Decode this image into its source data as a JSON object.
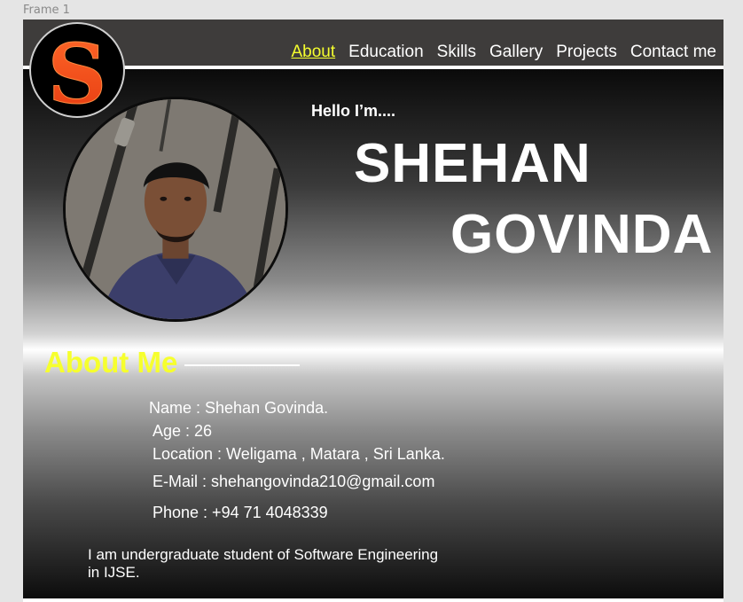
{
  "frame": {
    "label": "Frame 1"
  },
  "logo": {
    "letter": "S",
    "letter_color": "#ff4d1a"
  },
  "nav": {
    "items": [
      {
        "label": "About",
        "active": true
      },
      {
        "label": "Education",
        "active": false
      },
      {
        "label": "Skills",
        "active": false
      },
      {
        "label": "Gallery",
        "active": false
      },
      {
        "label": "Projects",
        "active": false
      },
      {
        "label": "Contact me",
        "active": false
      }
    ],
    "active_color": "#f6ff2e"
  },
  "hero": {
    "greeting": "Hello I’m....",
    "first_name": "SHEHAN",
    "last_name": "GOVINDA"
  },
  "about": {
    "heading": "About Me",
    "name": "Name : Shehan Govinda.",
    "age": "Age : 26",
    "location": "Location : Weligama , Matara , Sri Lanka.",
    "email": "E-Mail : shehangovinda210@gmail.com",
    "phone": "Phone : +94 71  4048339",
    "bio_line1": "I am undergraduate student of Software Engineering",
    "bio_line2": "in IJSE."
  },
  "colors": {
    "header_bg": "#3e3c3b",
    "heading_yellow": "#f6ff2e"
  }
}
